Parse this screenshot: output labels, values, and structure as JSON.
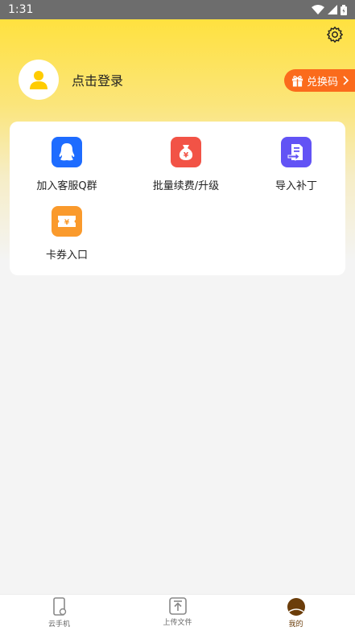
{
  "status_bar": {
    "time": "1:31"
  },
  "header": {
    "login_text": "点击登录",
    "redeem_label": "兑换码",
    "icons": {
      "settings": "gear-icon",
      "avatar": "user-icon",
      "gift": "gift-icon"
    }
  },
  "menu": {
    "items": [
      {
        "label": "加入客服Q群",
        "icon": "qq-penguin-icon",
        "color": "#1e6cff"
      },
      {
        "label": "批量续费/升级",
        "icon": "money-bag-icon",
        "color": "#f25346"
      },
      {
        "label": "导入补丁",
        "icon": "import-file-icon",
        "color": "#6253f5"
      },
      {
        "label": "卡券入口",
        "icon": "coupon-icon",
        "color": "#fa9a2c"
      }
    ]
  },
  "bottom_nav": {
    "items": [
      {
        "label": "云手机",
        "icon": "phone-icon"
      },
      {
        "label": "上传文件",
        "icon": "upload-icon"
      },
      {
        "label": "我的",
        "icon": "profile-icon",
        "active": true
      }
    ]
  },
  "colors": {
    "accent": "#ffe13f",
    "redeem": "#fb6b1c",
    "active_nav": "#6b3d0a"
  }
}
